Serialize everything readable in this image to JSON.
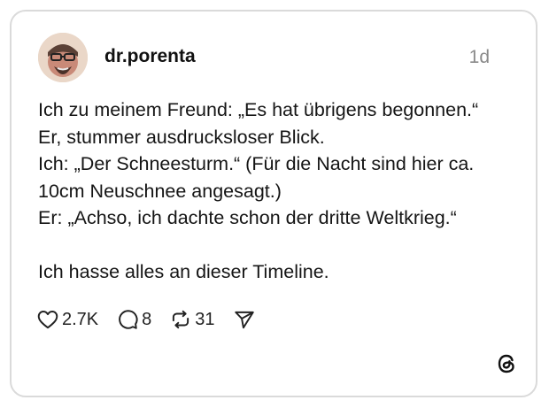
{
  "post": {
    "username": "dr.porenta",
    "timestamp": "1d",
    "lines": [
      "Ich zu meinem Freund: „Es hat übrigens begonnen.“",
      "Er, stummer ausdrucksloser Blick.",
      "Ich: „Der Schneesturm.“ (Für die Nacht sind hier ca.",
      "10cm Neuschnee angesagt.)",
      "Er: „Achso, ich dachte schon der dritte Weltkrieg.“",
      "Ich hasse alles an dieser Timeline."
    ]
  },
  "actions": {
    "likes": "2.7K",
    "replies": "8",
    "reposts": "31"
  },
  "icons": {
    "like": "heart-icon",
    "reply": "comment-icon",
    "repost": "repost-icon",
    "share": "send-icon",
    "brand": "threads-logo-icon"
  },
  "colors": {
    "border": "#dadada",
    "timestamp": "#8a8a8a",
    "text": "#151515"
  }
}
